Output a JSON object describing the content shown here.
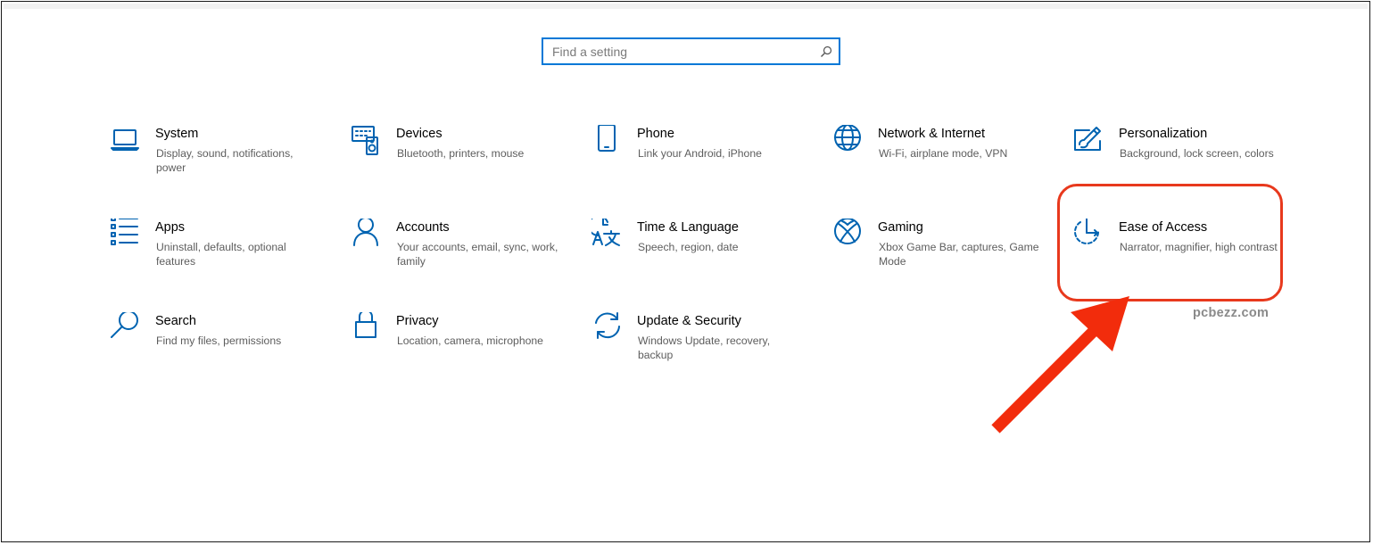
{
  "search": {
    "placeholder": "Find a setting"
  },
  "tiles": [
    {
      "title": "System",
      "desc": "Display, sound, notifications, power",
      "icon": "laptop-icon"
    },
    {
      "title": "Devices",
      "desc": "Bluetooth, printers, mouse",
      "icon": "keyboard-speaker-icon"
    },
    {
      "title": "Phone",
      "desc": "Link your Android, iPhone",
      "icon": "phone-icon"
    },
    {
      "title": "Network & Internet",
      "desc": "Wi-Fi, airplane mode, VPN",
      "icon": "globe-icon"
    },
    {
      "title": "Personalization",
      "desc": "Background, lock screen, colors",
      "icon": "paint-brush-icon"
    },
    {
      "title": "Apps",
      "desc": "Uninstall, defaults, optional features",
      "icon": "apps-list-icon"
    },
    {
      "title": "Accounts",
      "desc": "Your accounts, email, sync, work, family",
      "icon": "person-icon"
    },
    {
      "title": "Time & Language",
      "desc": "Speech, region, date",
      "icon": "clock-language-icon"
    },
    {
      "title": "Gaming",
      "desc": "Xbox Game Bar, captures, Game Mode",
      "icon": "xbox-icon"
    },
    {
      "title": "Ease of Access",
      "desc": "Narrator, magnifier, high contrast",
      "icon": "ease-of-access-icon"
    },
    {
      "title": "Search",
      "desc": "Find my files, permissions",
      "icon": "magnifier-icon"
    },
    {
      "title": "Privacy",
      "desc": "Location, camera, microphone",
      "icon": "lock-icon"
    },
    {
      "title": "Update & Security",
      "desc": "Windows Update, recovery, backup",
      "icon": "sync-arrows-icon"
    }
  ],
  "watermark": "pcbezz.com",
  "colors": {
    "accent": "#0078d7",
    "icon": "#0063b1",
    "highlight": "#e8391d"
  }
}
